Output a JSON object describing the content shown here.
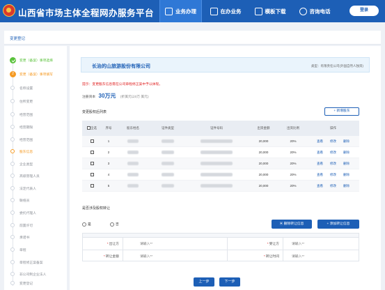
{
  "header": {
    "title": "山西省市场主体全程网办服务平台",
    "nav": [
      {
        "label": "业务办理",
        "icon": "briefcase-icon"
      },
      {
        "label": "在办业务",
        "icon": "document-icon"
      },
      {
        "label": "模板下载",
        "icon": "download-icon"
      },
      {
        "label": "咨询电话",
        "icon": "phone-icon"
      }
    ],
    "login_label": "登录"
  },
  "subbar": {
    "title": "变更登记"
  },
  "steps": [
    {
      "label": "变更（备案）事项选择",
      "state": "done"
    },
    {
      "label": "变更（备案）事项填写",
      "state": "current"
    },
    {
      "label": "名称设置",
      "state": "pending"
    },
    {
      "label": "住所变更",
      "state": "pending"
    },
    {
      "label": "经营范围",
      "state": "pending"
    },
    {
      "label": "经营期限",
      "state": "pending"
    },
    {
      "label": "经营范围",
      "state": "pending"
    },
    {
      "label": "股东信息",
      "state": "active"
    },
    {
      "label": "企业类型",
      "state": "pending"
    },
    {
      "label": "高级管理人员",
      "state": "pending"
    },
    {
      "label": "法定代表人",
      "state": "pending"
    },
    {
      "label": "联络员",
      "state": "pending"
    },
    {
      "label": "委托代理人",
      "state": "pending"
    },
    {
      "label": "前置许可",
      "state": "pending"
    },
    {
      "label": "承诺书",
      "state": "pending"
    },
    {
      "label": "章程",
      "state": "pending"
    },
    {
      "label": "章程修正案备案",
      "state": "pending"
    },
    {
      "label": "非公司制企业法人",
      "state": "pending"
    },
    {
      "label": "变更登记",
      "state": "pending"
    }
  ],
  "company": {
    "name": "长治的山旅游股份有限公司",
    "type": "类型：有限责任公司(外国自然人独资)"
  },
  "tip": "提示：变更股东信息需在公司章程修正案中予以体现。",
  "capital": {
    "label": "注册资本",
    "value": "30万元",
    "note": "(折美元以0万 美元)"
  },
  "shareholders": {
    "title": "变更股权后列表",
    "add_label": "+ 新增股东",
    "columns": [
      "全选",
      "序号",
      "股东姓名",
      "证件类型",
      "证件号码",
      "出资金额",
      "出资比例",
      "操作"
    ],
    "rows": [
      {
        "no": "1",
        "amount": "20,000",
        "ratio": "20%"
      },
      {
        "no": "2",
        "amount": "20,000",
        "ratio": "20%"
      },
      {
        "no": "3",
        "amount": "20,000",
        "ratio": "20%"
      },
      {
        "no": "4",
        "amount": "20,000",
        "ratio": "20%"
      },
      {
        "no": "5",
        "amount": "20,000",
        "ratio": "20%"
      }
    ],
    "actions": [
      "查看",
      "修改",
      "删除"
    ]
  },
  "transfer": {
    "question": "是否涉及股权转让",
    "yes": "是",
    "no": "否",
    "delete_label": "删除转让信息",
    "add_label": "+ 添加转让信息",
    "fields": [
      {
        "label": "出让方",
        "placeholder": "请输入**"
      },
      {
        "label": "受让方",
        "placeholder": "请输入**"
      },
      {
        "label": "转让金额",
        "placeholder": "请输入**"
      },
      {
        "label": "转让时间",
        "placeholder": "请输入**"
      }
    ]
  },
  "footer": {
    "prev_label": "上一步",
    "next_label": "下一步"
  }
}
